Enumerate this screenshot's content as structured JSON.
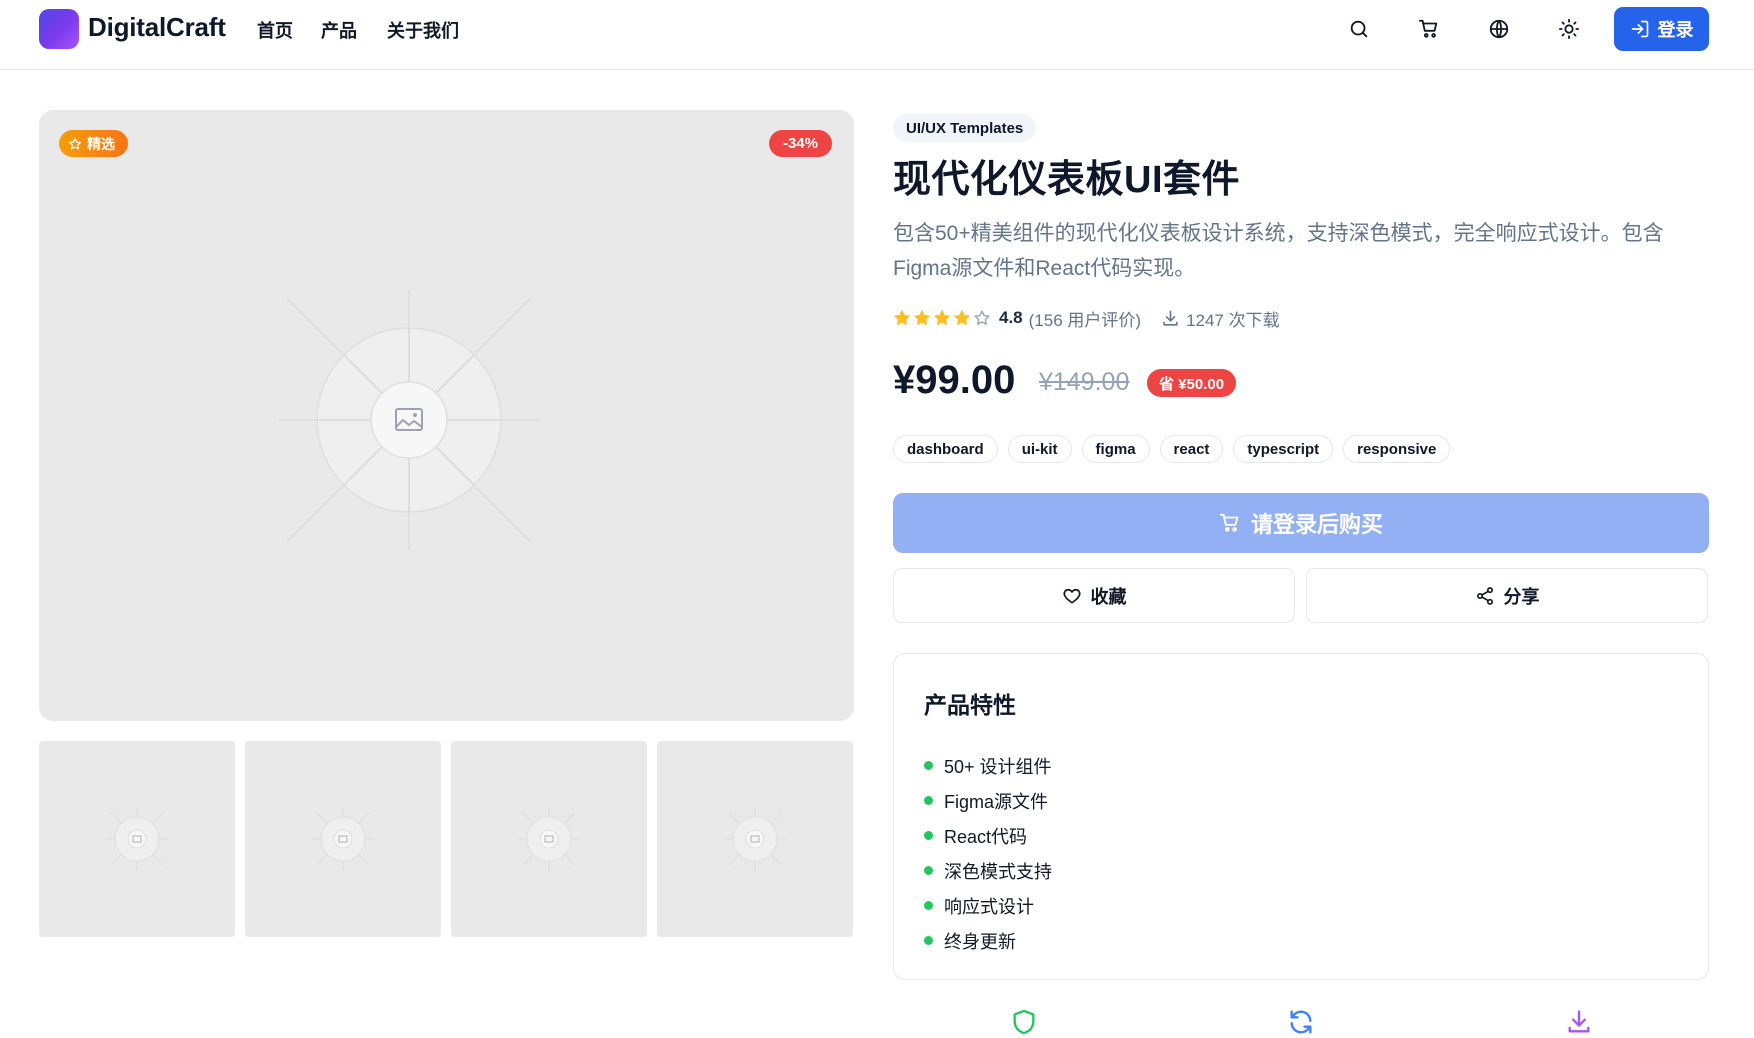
{
  "header": {
    "brand": "DigitalCraft",
    "nav": [
      "首页",
      "产品",
      "关于我们"
    ],
    "icons": [
      "search-icon",
      "cart-icon",
      "globe-icon",
      "sun-icon"
    ],
    "login_label": "登录"
  },
  "gallery": {
    "featured_badge": "精选",
    "discount_badge": "-34%",
    "thumbnail_count": 4
  },
  "product": {
    "category": "UI/UX Templates",
    "title": "现代化仪表板UI套件",
    "description": "包含50+精美组件的现代化仪表板设计系统，支持深色模式，完全响应式设计。包含Figma源文件和React代码实现。",
    "rating": 4.8,
    "rating_value": "4.8",
    "rating_count": "(156 用户评价)",
    "stars_filled": 4,
    "downloads": "1247 次下载",
    "price": "¥99.00",
    "original_price": "¥149.00",
    "save_label": "省 ¥50.00",
    "tags": [
      "dashboard",
      "ui-kit",
      "figma",
      "react",
      "typescript",
      "responsive"
    ],
    "buy_label": "请登录后购买",
    "favorite_label": "收藏",
    "share_label": "分享"
  },
  "features": {
    "title": "产品特性",
    "items": [
      "50+ 设计组件",
      "Figma源文件",
      "React代码",
      "深色模式支持",
      "响应式设计",
      "终身更新"
    ]
  },
  "colors": {
    "primary": "#2563eb",
    "buy_disabled": "#93b0f4",
    "discount": "#ef4444",
    "featured": "#f59e0b",
    "feature_dot": "#22c55e",
    "star": "#fbbf24"
  },
  "bottom_icons": [
    "shield-icon",
    "refresh-icon",
    "download-icon"
  ]
}
